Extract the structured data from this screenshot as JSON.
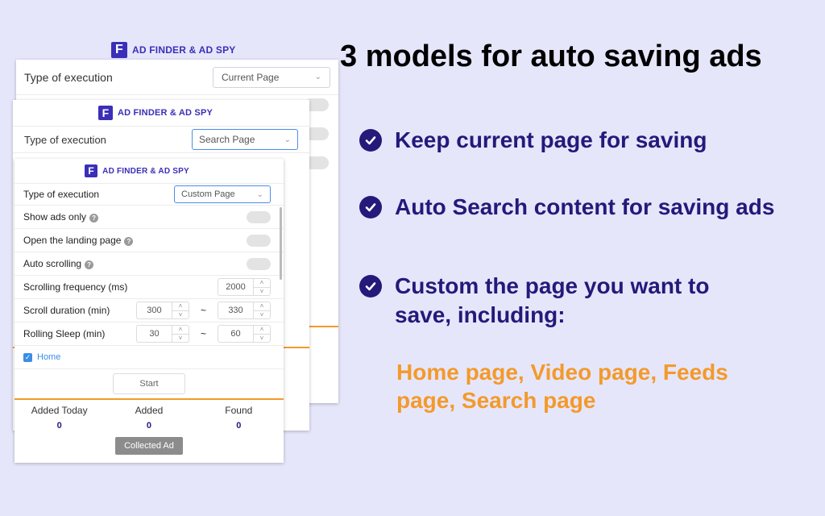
{
  "brand": {
    "name": "AD FINDER & AD SPY",
    "mark": "F"
  },
  "headline": "3 models for auto saving ads",
  "features": [
    {
      "text": "Keep current page for saving"
    },
    {
      "text": "Auto Search content for saving ads"
    },
    {
      "text": "Custom the page you want to save, including:"
    }
  ],
  "page_types_highlight": "Home page, Video page, Feeds page, Search page",
  "colors": {
    "background": "#e6e6fb",
    "brand": "#3b2fb8",
    "feature_text": "#231a7a",
    "highlight": "#f39a2b",
    "accent_line": "#f39a2b"
  },
  "panels": {
    "back": {
      "label": "Type of execution",
      "select_value": "Current Page"
    },
    "middle": {
      "label": "Type of execution",
      "select_value": "Search Page"
    },
    "front": {
      "label": "Type of execution",
      "select_value": "Custom Page",
      "show_ads_only": "Show ads only",
      "open_landing": "Open the landing page",
      "auto_scrolling": "Auto scrolling",
      "scroll_freq_label": "Scrolling frequency (ms)",
      "scroll_freq_value": "2000",
      "scroll_duration_label": "Scroll duration (min)",
      "scroll_duration_min": "300",
      "scroll_duration_max": "330",
      "rolling_sleep_label": "Rolling Sleep (min)",
      "rolling_sleep_min": "30",
      "rolling_sleep_max": "60",
      "range_sep": "~",
      "home_checkbox": "Home",
      "start_button": "Start",
      "stats": [
        {
          "label": "Added Today",
          "value": "0"
        },
        {
          "label": "Added",
          "value": "0"
        },
        {
          "label": "Found",
          "value": "0"
        }
      ],
      "collected_button": "Collected Ad"
    }
  },
  "icons": {
    "help": "question-icon",
    "check": "check-circle-icon",
    "chevron": "chevron-down-icon"
  }
}
